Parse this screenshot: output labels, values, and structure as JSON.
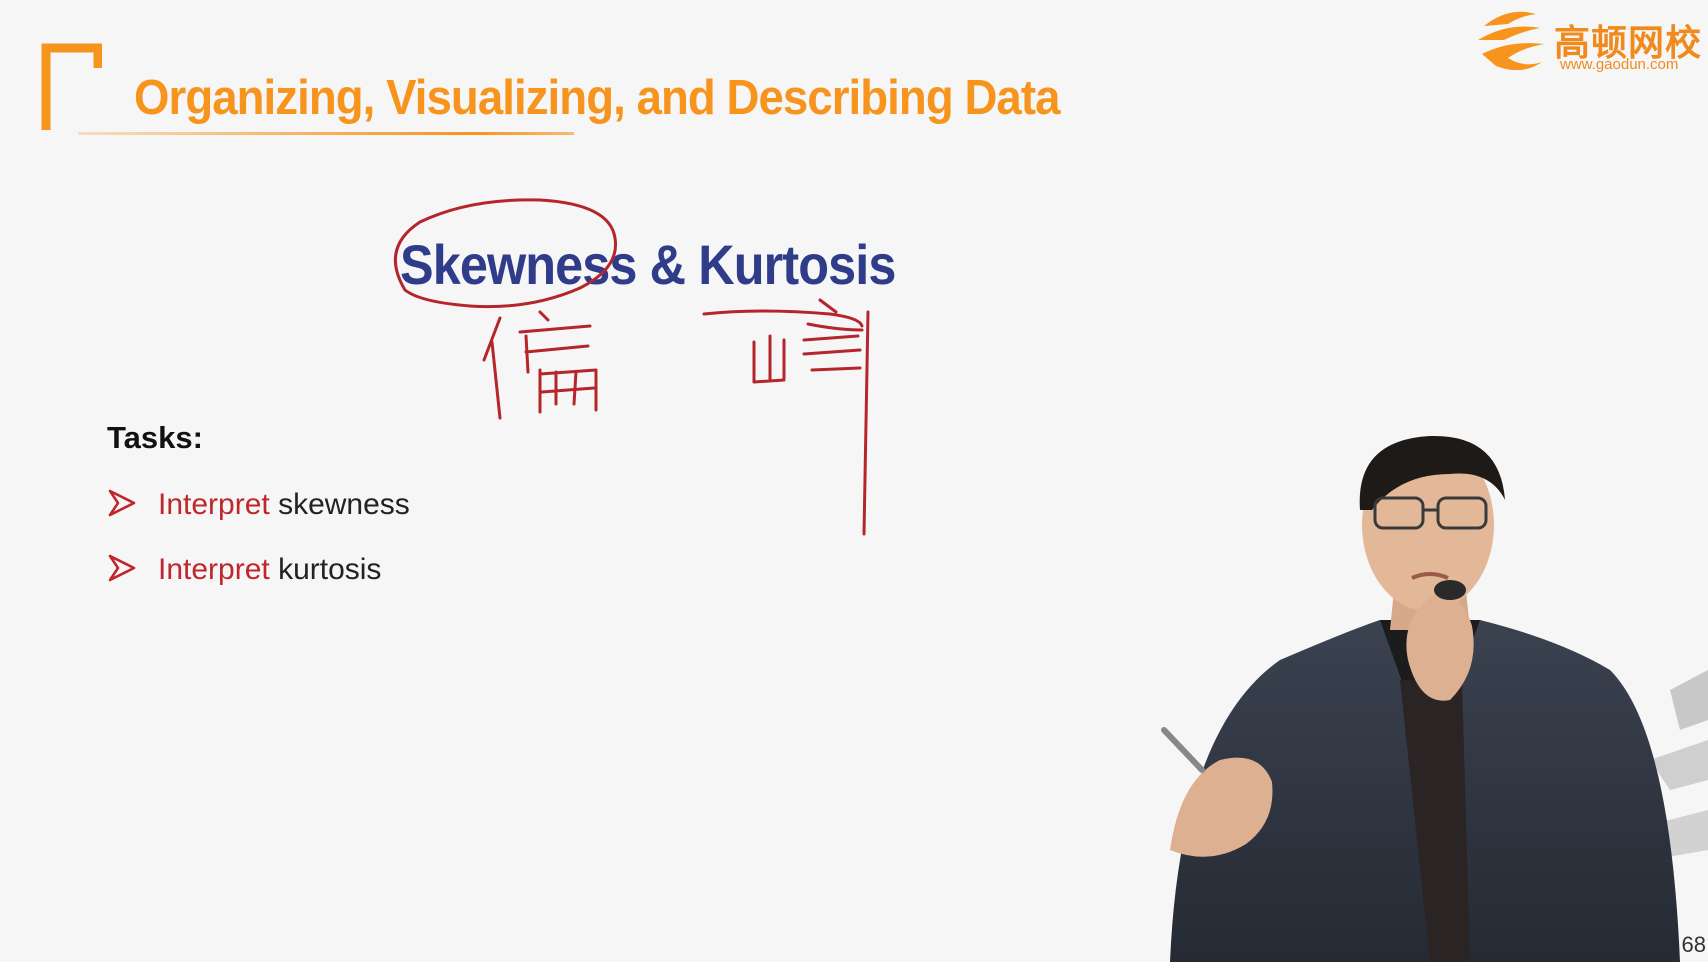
{
  "slide": {
    "title": "Organizing, Visualizing, and Describing Data",
    "subtitle": "Skewness & Kurtosis",
    "tasks_heading": "Tasks:",
    "tasks": [
      {
        "verb": "Interpret",
        "object": " skewness"
      },
      {
        "verb": "Interpret",
        "object": " kurtosis"
      }
    ],
    "slide_number": "68"
  },
  "logo": {
    "name": "高顿网校",
    "url": "www.gaodun.com"
  },
  "colors": {
    "accent_orange": "#f7941d",
    "subtitle_blue": "#2f3c8a",
    "task_verb_red": "#c0272d",
    "task_text": "#222222",
    "annotation_red": "#b4262b",
    "background": "#f6f6f6"
  },
  "icons": {
    "corner": "orange-corner-bracket-icon",
    "bullet": "arrowhead-bullet-icon",
    "logo": "gaodun-logo-icon"
  }
}
